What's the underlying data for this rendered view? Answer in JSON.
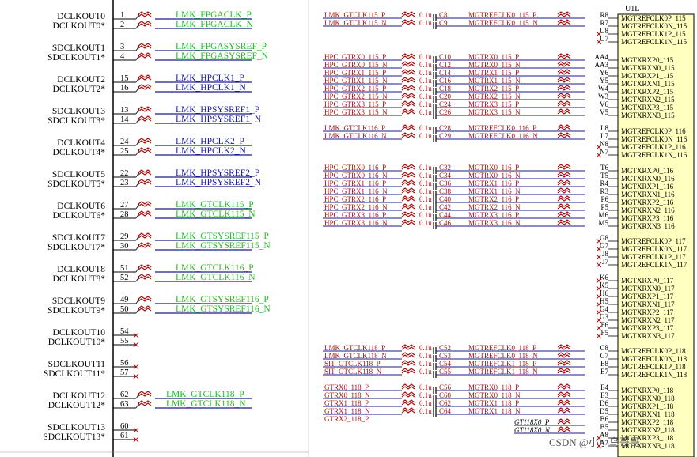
{
  "left_panel": {
    "rows": [
      {
        "pin_label_p": "DCLKOUT0",
        "pin_label_n": "DCLKOUT0*",
        "pin_p": "1",
        "pin_n": "2",
        "net_p": "LMK_FPGACLK_P",
        "net_n": "LMK_FPGACLK_N",
        "color": "#22bb22",
        "connected": true
      },
      {
        "pin_label_p": "SDCLKOUT1",
        "pin_label_n": "SDCLKOUT1*",
        "pin_p": "3",
        "pin_n": "4",
        "net_p": "LMK_FPGASYSREF_P",
        "net_n": "LMK_FPGASYSREF_N",
        "color": "#22bb22",
        "connected": true
      },
      {
        "pin_label_p": "DCLKOUT2",
        "pin_label_n": "DCLKOUT2*",
        "pin_p": "15",
        "pin_n": "16",
        "net_p": "LMK_HPCLK1_P",
        "net_n": "LMK_HPCLK1_N",
        "color": "#1a1aaa",
        "connected": true
      },
      {
        "pin_label_p": "SDCLKOUT3",
        "pin_label_n": "SDCLKOUT3*",
        "pin_p": "13",
        "pin_n": "14",
        "net_p": "LMK_HPSYSREF1_P",
        "net_n": "LMK_HPSYSREF1_N",
        "color": "#1a1aaa",
        "connected": true
      },
      {
        "pin_label_p": "DCLKOUT4",
        "pin_label_n": "DCLKOUT4*",
        "pin_p": "24",
        "pin_n": "25",
        "net_p": "LMK_HPCLK2_P",
        "net_n": "LMK_HPCLK2_N",
        "color": "#1a1aaa",
        "connected": true
      },
      {
        "pin_label_p": "SDCLKOUT5",
        "pin_label_n": "SDCLKOUT5*",
        "pin_p": "22",
        "pin_n": "23",
        "net_p": "LMK_HPSYSREF2_P",
        "net_n": "LMK_HPSYSREF2_N",
        "color": "#1a1aaa",
        "connected": true
      },
      {
        "pin_label_p": "DCLKOUT6",
        "pin_label_n": "DCLKOUT6*",
        "pin_p": "27",
        "pin_n": "28",
        "net_p": "LMK_GTCLK115_P",
        "net_n": "LMK_GTCLK115_N",
        "color": "#22bb22",
        "connected": true
      },
      {
        "pin_label_p": "SDCLKOUT7",
        "pin_label_n": "SDCLKOUT7*",
        "pin_p": "29",
        "pin_n": "30",
        "net_p": "LMK_GTSYSREF115_P",
        "net_n": "LMK_GTSYSREF115_N",
        "color": "#22bb22",
        "connected": true
      },
      {
        "pin_label_p": "DCLKOUT8",
        "pin_label_n": "DCLKOUT8*",
        "pin_p": "51",
        "pin_n": "52",
        "net_p": "LMK_GTCLK116_P",
        "net_n": "LMK_GTCLK116_N",
        "color": "#22bb22",
        "connected": true
      },
      {
        "pin_label_p": "SDCLKOUT9",
        "pin_label_n": "SDCLKOUT9*",
        "pin_p": "49",
        "pin_n": "50",
        "net_p": "LMK_GTSYSREF116_P",
        "net_n": "LMK_GTSYSREF116_N",
        "color": "#22bb22",
        "connected": true
      },
      {
        "pin_label_p": "DCLKOUT10",
        "pin_label_n": "DCLKOUT10*",
        "pin_p": "54",
        "pin_n": "55",
        "net_p": "",
        "net_n": "",
        "color": "#22bb22",
        "connected": false
      },
      {
        "pin_label_p": "SDCLKOUT11",
        "pin_label_n": "SDCLKOUT11*",
        "pin_p": "56",
        "pin_n": "57",
        "net_p": "",
        "net_n": "",
        "color": "#22bb22",
        "connected": false
      },
      {
        "pin_label_p": "DCLKOUT12",
        "pin_label_n": "DCLKOUT12*",
        "pin_p": "62",
        "pin_n": "63",
        "net_p": "LMK_GTCLK118_P",
        "net_n": "LMK_GTCLK118_N",
        "color": "#22bb22",
        "connected": true
      },
      {
        "pin_label_p": "SDCLKOUT13",
        "pin_label_n": "SDCLKOUT13*",
        "pin_p": "60",
        "pin_n": "61",
        "net_p": "",
        "net_n": "",
        "color": "#22bb22",
        "connected": false
      }
    ]
  },
  "right_panel": {
    "component_ref": "U1L",
    "rows": [
      {
        "net": "LMK_GTCLK115_P",
        "cap_value": "0.1u",
        "cap_ref": "C8",
        "out_net": "MGTREFCLK0_115_P",
        "pin": "R8",
        "port": "MGTREFCLK0P_115"
      },
      {
        "net": "LMK_GTCLK115_N",
        "cap_value": "0.1u",
        "cap_ref": "C9",
        "out_net": "MGTREFCLK0_115_N",
        "pin": "R7",
        "port": "MGTREFCLK0N_115"
      },
      {
        "net": "",
        "cap_value": "",
        "cap_ref": "",
        "out_net": "",
        "pin": "U8",
        "port": "MGTREFCLK1P_115"
      },
      {
        "net": "",
        "cap_value": "",
        "cap_ref": "",
        "out_net": "",
        "pin": "U7",
        "port": "MGTREFCLK1N_115"
      },
      {
        "net": "HPC_GTRX0_115_P",
        "cap_value": "0.1u",
        "cap_ref": "C10",
        "out_net": "MGTRX0_115_P",
        "pin": "AA4",
        "port": "MGTXRXP0_115"
      },
      {
        "net": "HPC_GTRX0_115_N",
        "cap_value": "0.1u",
        "cap_ref": "C12",
        "out_net": "MGTRX0_115_N",
        "pin": "AA3",
        "port": "MGTXRXN0_115"
      },
      {
        "net": "HPC_GTRX1_115_P",
        "cap_value": "0.1u",
        "cap_ref": "C14",
        "out_net": "MGTRX1_115_P",
        "pin": "Y6",
        "port": "MGTXRXP1_115"
      },
      {
        "net": "HPC_GTRX1_115_N",
        "cap_value": "0.1u",
        "cap_ref": "C16",
        "out_net": "MGTRX1_115_N",
        "pin": "Y5",
        "port": "MGTXRXN1_115"
      },
      {
        "net": "HPC_GTRX2_115_P",
        "cap_value": "0.1u",
        "cap_ref": "C18",
        "out_net": "MGTRX2_115_P",
        "pin": "W4",
        "port": "MGTXRXP2_115"
      },
      {
        "net": "HPC_GTRX2_115_N",
        "cap_value": "0.1u",
        "cap_ref": "C20",
        "out_net": "MGTRX2_115_N",
        "pin": "W3",
        "port": "MGTXRXN2_115"
      },
      {
        "net": "HPC_GTRX3_115_P",
        "cap_value": "0.1u",
        "cap_ref": "C24",
        "out_net": "MGTRX3_115_P",
        "pin": "V6",
        "port": "MGTXRXP3_115"
      },
      {
        "net": "HPC_GTRX3_115_N",
        "cap_value": "0.1u",
        "cap_ref": "C26",
        "out_net": "MGTRX3_115_N",
        "pin": "V5",
        "port": "MGTXRXN3_115"
      },
      {
        "net": "LMK_GTCLK116_P",
        "cap_value": "0.1u",
        "cap_ref": "C28",
        "out_net": "MGTREFCLK0_116_P",
        "pin": "L8",
        "port": "MGTREFCLK0P_116"
      },
      {
        "net": "LMK_GTCLK116_N",
        "cap_value": "0.1u",
        "cap_ref": "C29",
        "out_net": "MGTREFCLK0_116_N",
        "pin": "L7",
        "port": "MGTREFCLK0N_116"
      },
      {
        "net": "",
        "cap_value": "",
        "cap_ref": "",
        "out_net": "",
        "pin": "N8",
        "port": "MGTREFCLK1P_116"
      },
      {
        "net": "",
        "cap_value": "",
        "cap_ref": "",
        "out_net": "",
        "pin": "N7",
        "port": "MGTREFCLK1N_116"
      },
      {
        "net": "HPC_GTRX0_116_P",
        "cap_value": "0.1u",
        "cap_ref": "C32",
        "out_net": "MGTRX0_116_P",
        "pin": "T6",
        "port": "MGTXRXP0_116"
      },
      {
        "net": "HPC_GTRX0_116_N",
        "cap_value": "0.1u",
        "cap_ref": "C34",
        "out_net": "MGTRX0_116_N",
        "pin": "T5",
        "port": "MGTXRXN0_116"
      },
      {
        "net": "HPC_GTRX1_116_P",
        "cap_value": "0.1u",
        "cap_ref": "C36",
        "out_net": "MGTRX1_116_P",
        "pin": "R4",
        "port": "MGTXRXP1_116"
      },
      {
        "net": "HPC_GTRX1_116_N",
        "cap_value": "0.1u",
        "cap_ref": "C38",
        "out_net": "MGTRX1_116_N",
        "pin": "R3",
        "port": "MGTXRXN1_116"
      },
      {
        "net": "HPC_GTRX2_116_P",
        "cap_value": "0.1u",
        "cap_ref": "C40",
        "out_net": "MGTRX2_116_P",
        "pin": "P6",
        "port": "MGTXRXP2_116"
      },
      {
        "net": "HPC_GTRX2_116_N",
        "cap_value": "0.1u",
        "cap_ref": "C42",
        "out_net": "MGTRX2_116_N",
        "pin": "P5",
        "port": "MGTXRXN2_116"
      },
      {
        "net": "HPC_GTRX3_116_P",
        "cap_value": "0.1u",
        "cap_ref": "C44",
        "out_net": "MGTRX3_116_P",
        "pin": "M6",
        "port": "MGTXRXP3_116"
      },
      {
        "net": "HPC_GTRX3_116_N",
        "cap_value": "0.1u",
        "cap_ref": "C46",
        "out_net": "MGTRX3_116_N",
        "pin": "M5",
        "port": "MGTXRXN3_116"
      },
      {
        "net": "",
        "cap_value": "",
        "cap_ref": "",
        "out_net": "",
        "pin": "G8",
        "port": "MGTREFCLK0P_117"
      },
      {
        "net": "",
        "cap_value": "",
        "cap_ref": "",
        "out_net": "",
        "pin": "G7",
        "port": "MGTREFCLK0N_117"
      },
      {
        "net": "",
        "cap_value": "",
        "cap_ref": "",
        "out_net": "",
        "pin": "J8",
        "port": "MGTREFCLK1P_117"
      },
      {
        "net": "",
        "cap_value": "",
        "cap_ref": "",
        "out_net": "",
        "pin": "J7",
        "port": "MGTREFCLK1N_117"
      },
      {
        "net": "",
        "cap_value": "",
        "cap_ref": "",
        "out_net": "",
        "pin": "K6",
        "port": "MGTXRXP0_117"
      },
      {
        "net": "",
        "cap_value": "",
        "cap_ref": "",
        "out_net": "",
        "pin": "K5",
        "port": "MGTXRXN0_117"
      },
      {
        "net": "",
        "cap_value": "",
        "cap_ref": "",
        "out_net": "",
        "pin": "H6",
        "port": "MGTXRXP1_117"
      },
      {
        "net": "",
        "cap_value": "",
        "cap_ref": "",
        "out_net": "",
        "pin": "H5",
        "port": "MGTXRXN1_117"
      },
      {
        "net": "",
        "cap_value": "",
        "cap_ref": "",
        "out_net": "",
        "pin": "G4",
        "port": "MGTXRXP2_117"
      },
      {
        "net": "",
        "cap_value": "",
        "cap_ref": "",
        "out_net": "",
        "pin": "G3",
        "port": "MGTXRXN2_117"
      },
      {
        "net": "",
        "cap_value": "",
        "cap_ref": "",
        "out_net": "",
        "pin": "F6",
        "port": "MGTXRXP3_117"
      },
      {
        "net": "",
        "cap_value": "",
        "cap_ref": "",
        "out_net": "",
        "pin": "F5",
        "port": "MGTXRXN3_117"
      },
      {
        "net": "LMK_GTCLK118_P",
        "cap_value": "0.1u",
        "cap_ref": "C52",
        "out_net": "MGTREFCLK0_118_P",
        "pin": "C8",
        "port": "MGTREFCLK0P_118"
      },
      {
        "net": "LMK_GTCLK118_N",
        "cap_value": "0.1u",
        "cap_ref": "C53",
        "out_net": "MGTREFCLK0_118_N",
        "pin": "C7",
        "port": "MGTREFCLK0N_118"
      },
      {
        "net": "SIT_GTCLK118_P",
        "cap_value": "0.1u",
        "cap_ref": "C54",
        "out_net": "MGTREFCLK1_118_P",
        "pin": "E8",
        "port": "MGTREFCLK1P_118"
      },
      {
        "net": "SIT_GTCLK118_N",
        "cap_value": "0.1u",
        "cap_ref": "C55",
        "out_net": "MGTREFCLK1_118_N",
        "pin": "E7",
        "port": "MGTREFCLK1N_118"
      },
      {
        "net": "GTRX0_118_P",
        "cap_value": "0.1u",
        "cap_ref": "C56",
        "out_net": "MGTRX0_118_P",
        "pin": "E4",
        "port": "MGTXRXP0_118"
      },
      {
        "net": "GTRX0_118_N",
        "cap_value": "0.1u",
        "cap_ref": "C60",
        "out_net": "MGTRX0_118_N",
        "pin": "E3",
        "port": "MGTXRXN0_118"
      },
      {
        "net": "GTRX1_118_P",
        "cap_value": "0.1u",
        "cap_ref": "C62",
        "out_net": "MGTRX1_118_P",
        "pin": "D6",
        "port": "MGTXRXP1_118"
      },
      {
        "net": "GTRX1_118_N",
        "cap_value": "0.1u",
        "cap_ref": "C64",
        "out_net": "MGTRX1_118_N",
        "pin": "D5",
        "port": "MGTXRXN1_118"
      },
      {
        "net": "GTRX2_118_P",
        "cap_value": "",
        "cap_ref": "",
        "out_net": "GT118X0_P",
        "pin": "B6",
        "port": "MGTXRXP2_118"
      },
      {
        "net": "",
        "cap_value": "",
        "cap_ref": "",
        "out_net": "GT118X0_N",
        "pin": "B5",
        "port": "MGTXRXN2_118"
      },
      {
        "net": "",
        "cap_value": "",
        "cap_ref": "",
        "out_net": "",
        "pin": "A8",
        "port": "MGTXRXP3_118"
      },
      {
        "net": "",
        "cap_value": "",
        "cap_ref": "",
        "out_net": "",
        "pin": "A7",
        "port": "MGTXRXN3_118"
      }
    ]
  },
  "watermark": "CSDN @小小鸟哥哥",
  "colors": {
    "red_net": "#aa1111",
    "blue_wire": "#1a1a88",
    "green_net": "#22bb22",
    "blue_net": "#1a1aaa",
    "chip_fill": "#ffffc0"
  }
}
